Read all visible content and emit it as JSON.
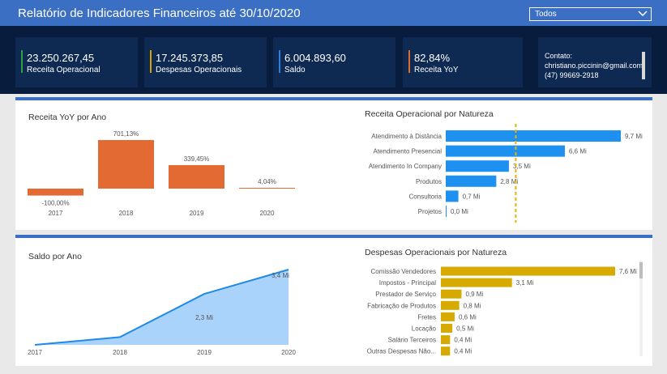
{
  "header": {
    "title": "Relatório de Indicadores Financeiros até 30/10/2020",
    "filter_value": "Todos"
  },
  "kpis": [
    {
      "value": "23.250.267,45",
      "label": "Receita Operacional",
      "accent": "#2ea043"
    },
    {
      "value": "17.245.373,85",
      "label": "Despesas Operacionais",
      "accent": "#d9a400"
    },
    {
      "value": "6.004.893,60",
      "label": "Saldo",
      "accent": "#2f7fd6"
    },
    {
      "value": "82,84%",
      "label": "Receita YoY",
      "accent": "#e06a2c"
    }
  ],
  "contact": {
    "title": "Contato:",
    "email": "christiano.piccinin@gmail.com",
    "phone": "(47) 99669-2918"
  },
  "colors": {
    "orange": "#e36b33",
    "blue": "#1e90f0",
    "gold": "#d6aa00",
    "area": "#a9d3fb",
    "line": "#1f8ae6"
  },
  "chart_data": [
    {
      "type": "bar",
      "title": "Receita YoY por Ano",
      "categories": [
        "2017",
        "2018",
        "2019",
        "2020"
      ],
      "values": [
        -100.0,
        701.13,
        339.45,
        4.04
      ],
      "data_labels": [
        "-100,00%",
        "701,13%",
        "339,45%",
        "4,04%"
      ],
      "ylim": [
        -100,
        701.13
      ]
    },
    {
      "type": "bar",
      "orientation": "horizontal",
      "title": "Receita Operacional por Natureza",
      "categories": [
        "Atendimento à Distância",
        "Atendimento Presencial",
        "Atendimento In Company",
        "Produtos",
        "Consultoria",
        "Projetos"
      ],
      "values": [
        9.7,
        6.6,
        3.5,
        2.8,
        0.7,
        0.0
      ],
      "data_labels": [
        "9,7 Mi",
        "6,6 Mi",
        "3,5 Mi",
        "2,8 Mi",
        "0,7 Mi",
        "0,0 Mi"
      ],
      "xlim": [
        0,
        9.7
      ],
      "reference_line": 3.88
    },
    {
      "type": "area",
      "title": "Saldo por Ano",
      "x": [
        "2017",
        "2018",
        "2019",
        "2020"
      ],
      "values": [
        0.0,
        0.35,
        2.3,
        3.4
      ],
      "data_labels": [
        "",
        "",
        "2,3 Mi",
        "3,4 Mi"
      ],
      "ylim": [
        0,
        3.4
      ]
    },
    {
      "type": "bar",
      "orientation": "horizontal",
      "title": "Despesas Operacionais por Natureza",
      "categories": [
        "Comissão Vendedores",
        "Impostos - Principal",
        "Prestador de Serviço",
        "Fabricação de Produtos",
        "Fretes",
        "Locação",
        "Salário Terceiros",
        "Outras Despesas Não..."
      ],
      "values": [
        7.6,
        3.1,
        0.9,
        0.8,
        0.6,
        0.5,
        0.4,
        0.4
      ],
      "data_labels": [
        "7,6 Mi",
        "3,1 Mi",
        "0,9 Mi",
        "0,8 Mi",
        "0,6 Mi",
        "0,5 Mi",
        "0,4 Mi",
        "0,4 Mi"
      ],
      "xlim": [
        0,
        7.6
      ]
    }
  ]
}
